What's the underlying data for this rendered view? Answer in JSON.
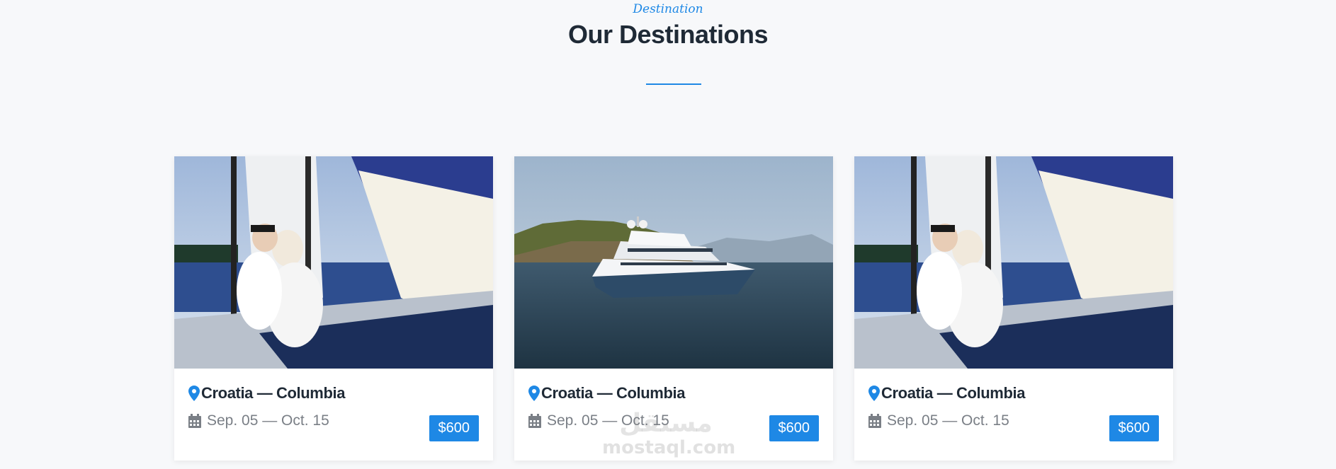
{
  "section": {
    "subtitle": "Destination",
    "title": "Our Destinations"
  },
  "cards": [
    {
      "image": "sailboat-couple-photo",
      "location": "Croatia — Columbia",
      "dates": "Sep. 05 — Oct. 15",
      "price": "$600"
    },
    {
      "image": "yacht-photo",
      "location": "Croatia — Columbia",
      "dates": "Sep. 05 — Oct. 15",
      "price": "$600"
    },
    {
      "image": "sailboat-couple-photo",
      "location": "Croatia — Columbia",
      "dates": "Sep. 05 — Oct. 15",
      "price": "$600"
    }
  ],
  "watermark": {
    "text": "mostaql.com",
    "logo": "مستقل"
  },
  "colors": {
    "accent": "#1e88e5",
    "heading": "#1f2a36",
    "muted": "#7a7f86",
    "background": "#f7f8fa"
  },
  "icons": {
    "location": "map-pin-icon",
    "date": "calendar-icon"
  }
}
